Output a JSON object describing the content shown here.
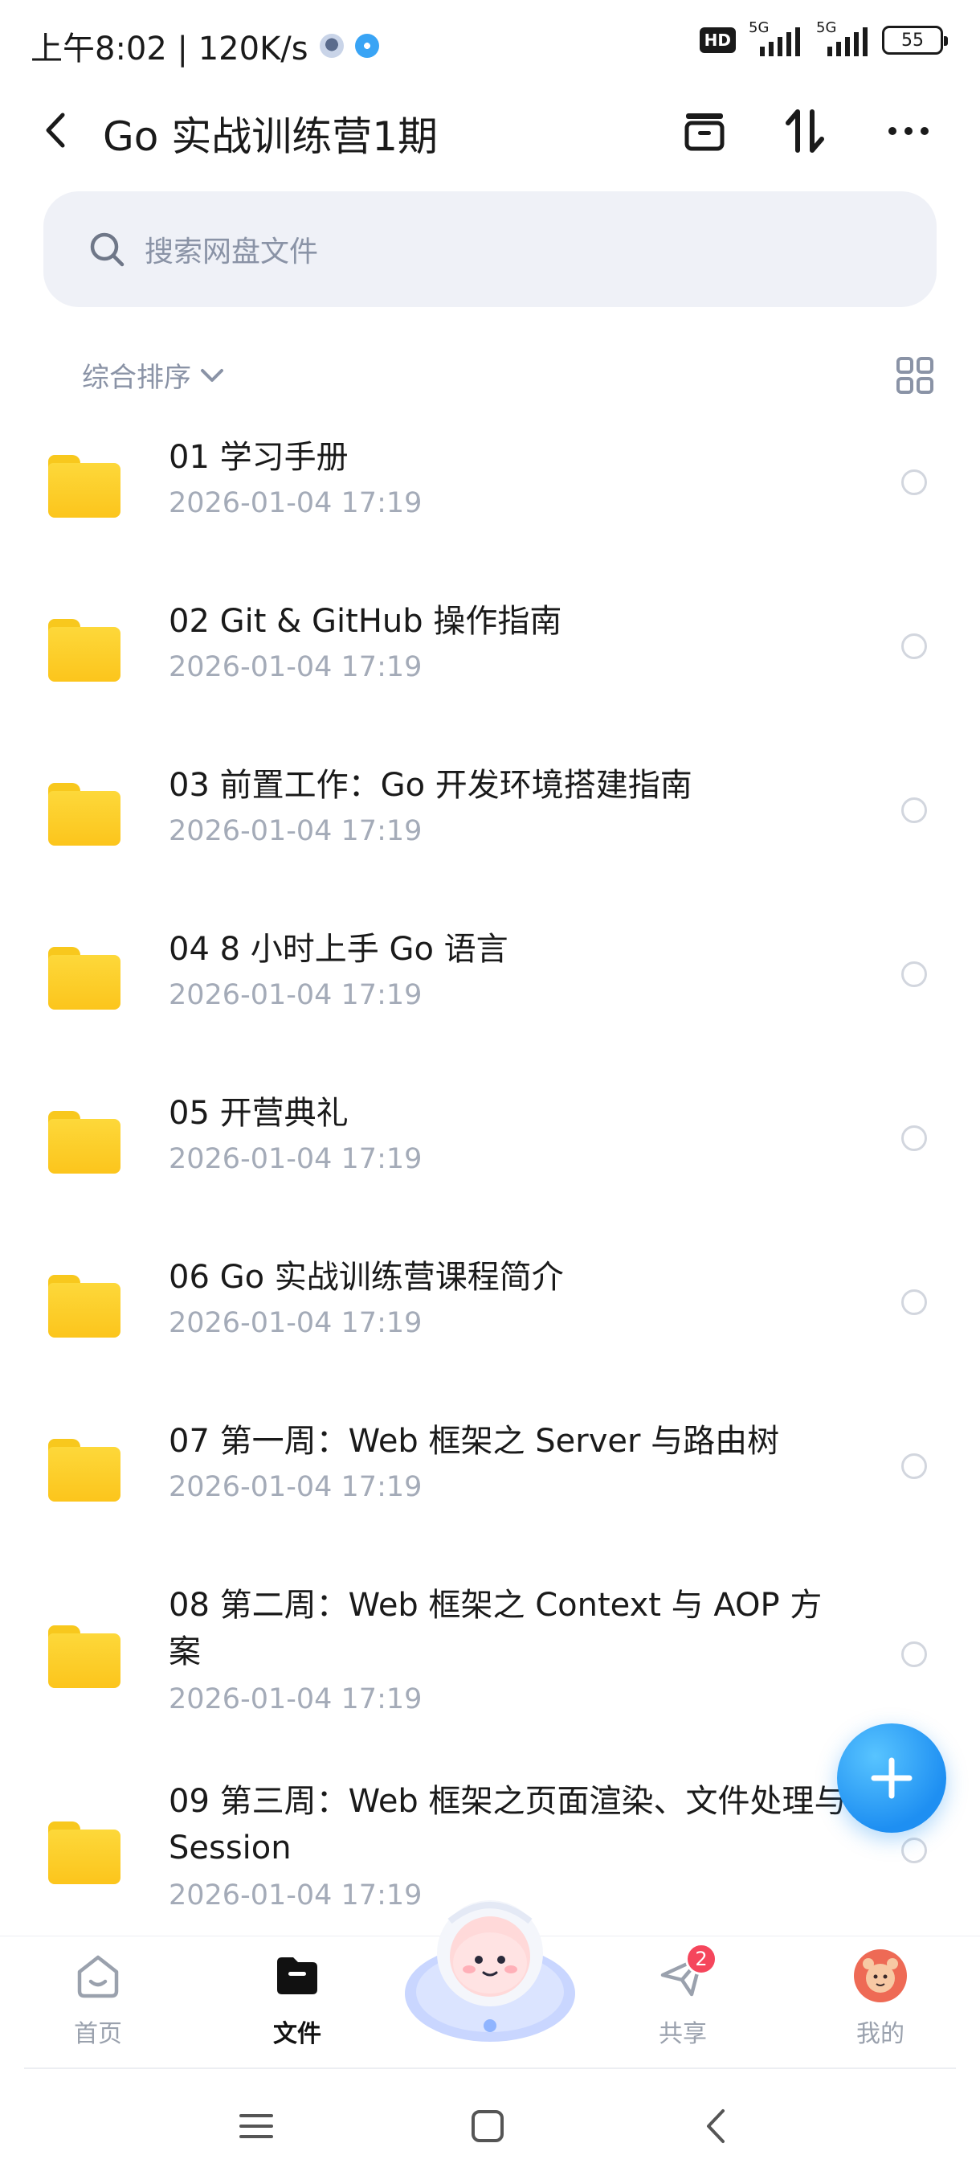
{
  "status_bar": {
    "time_speed": "上午8:02 | 120K/s",
    "hd": "HD",
    "sim1": "5G",
    "sim2": "5G",
    "battery": "55"
  },
  "header": {
    "title": "Go 实战训练营1期",
    "icons": [
      "back-arrow-icon",
      "archive-icon",
      "sort-arrows-icon",
      "more-icon"
    ]
  },
  "search": {
    "placeholder": "搜索网盘文件"
  },
  "sort": {
    "label": "综合排序"
  },
  "files": [
    {
      "name": "01 学习手册",
      "date": "2026-01-04  17:19"
    },
    {
      "name": "02 Git & GitHub 操作指南",
      "date": "2026-01-04  17:19"
    },
    {
      "name": "03 前置工作：Go 开发环境搭建指南",
      "date": "2026-01-04  17:19"
    },
    {
      "name": "04 8 小时上手 Go 语言",
      "date": "2026-01-04  17:19"
    },
    {
      "name": "05 开营典礼",
      "date": "2026-01-04  17:19"
    },
    {
      "name": "06 Go 实战训练营课程简介",
      "date": "2026-01-04  17:19"
    },
    {
      "name": "07 第一周：Web 框架之 Server 与路由树",
      "date": "2026-01-04  17:19"
    },
    {
      "name": "08 第二周：Web 框架之 Context 与 AOP 方案",
      "date": "2026-01-04  17:19"
    },
    {
      "name": "09 第三周：Web 框架之页面渲染、文件处理与 Session",
      "date": "2026-01-04  17:19"
    }
  ],
  "bottom_nav": {
    "home": "首页",
    "files": "文件",
    "share": "共享",
    "share_badge": "2",
    "mine": "我的"
  },
  "colors": {
    "accent": "#1e8ff2",
    "folder": "#fcc51c",
    "badge": "#f5465c"
  }
}
